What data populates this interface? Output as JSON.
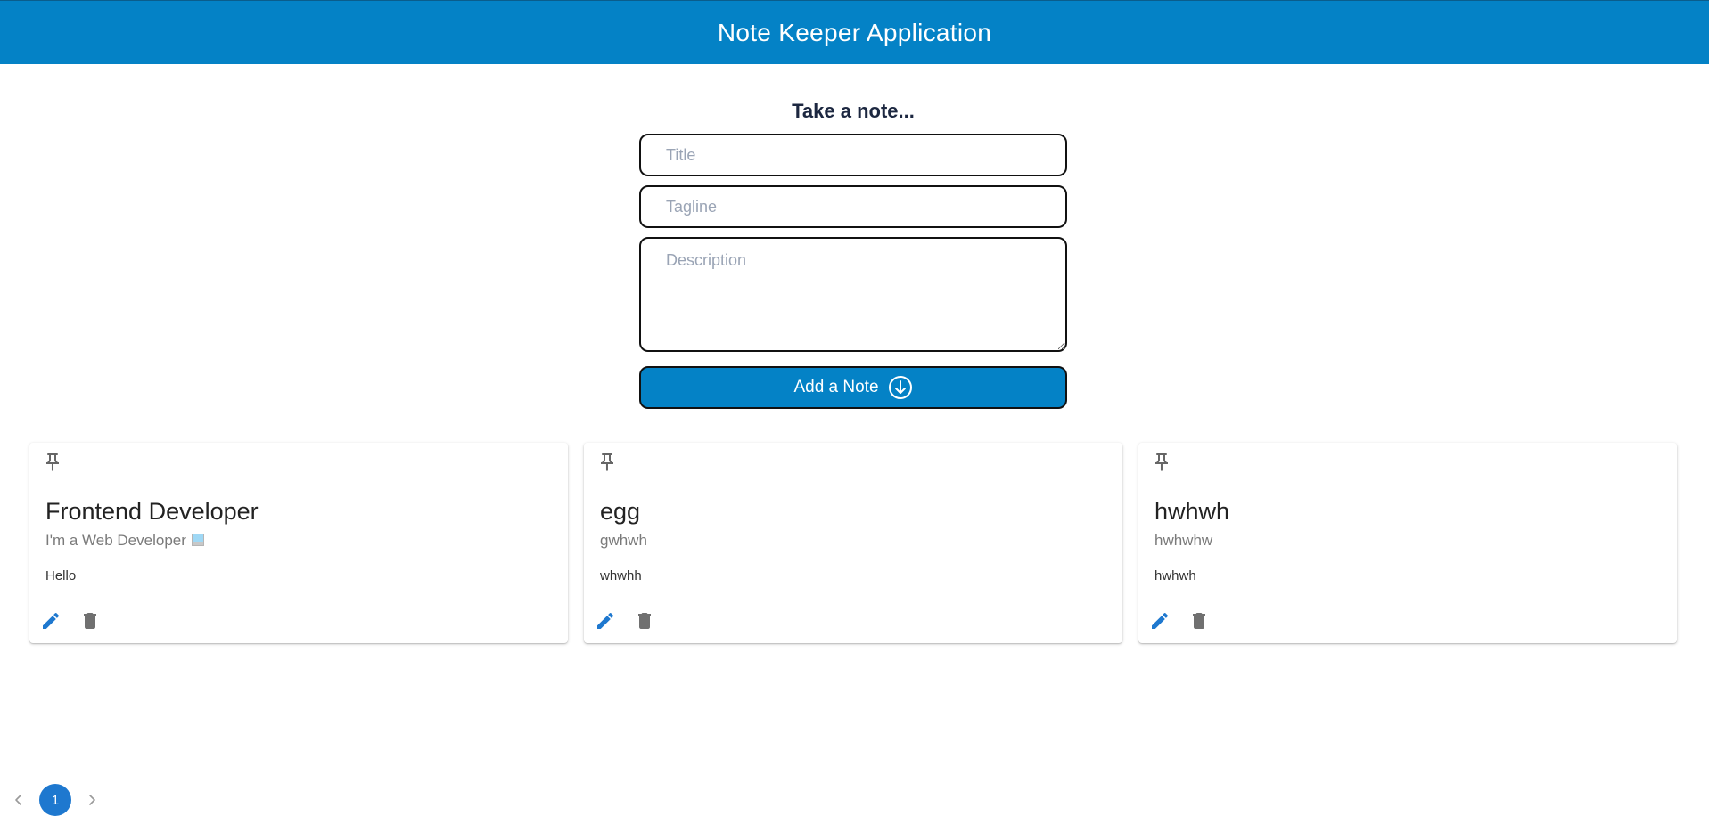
{
  "header": {
    "title": "Note Keeper Application",
    "background_color": "#0482c6"
  },
  "form": {
    "heading": "Take a note...",
    "title_placeholder": "Title",
    "tagline_placeholder": "Tagline",
    "description_placeholder": "Description",
    "add_button_label": "Add a Note",
    "add_button_icon": "arrow-down-circle-icon"
  },
  "notes": [
    {
      "pin_icon": "pin-icon",
      "title": "Frontend Developer",
      "tagline": "I'm a Web Developer",
      "description": "Hello",
      "edit_icon": "pencil-icon",
      "delete_icon": "trash-icon"
    },
    {
      "pin_icon": "pin-icon",
      "title": "egg",
      "tagline": "gwhwh",
      "description": "whwhh",
      "edit_icon": "pencil-icon",
      "delete_icon": "trash-icon"
    },
    {
      "pin_icon": "pin-icon",
      "title": "hwhwh",
      "tagline": "hwhwhw",
      "description": "hwhwh",
      "edit_icon": "pencil-icon",
      "delete_icon": "trash-icon"
    }
  ],
  "pagination": {
    "current_page": "1",
    "prev_icon": "chevron-left-icon",
    "next_icon": "chevron-right-icon"
  },
  "colors": {
    "primary": "#0482c6",
    "edit_icon": "#1e78cf",
    "delete_icon": "#707070",
    "page_active": "#1e78cf"
  }
}
